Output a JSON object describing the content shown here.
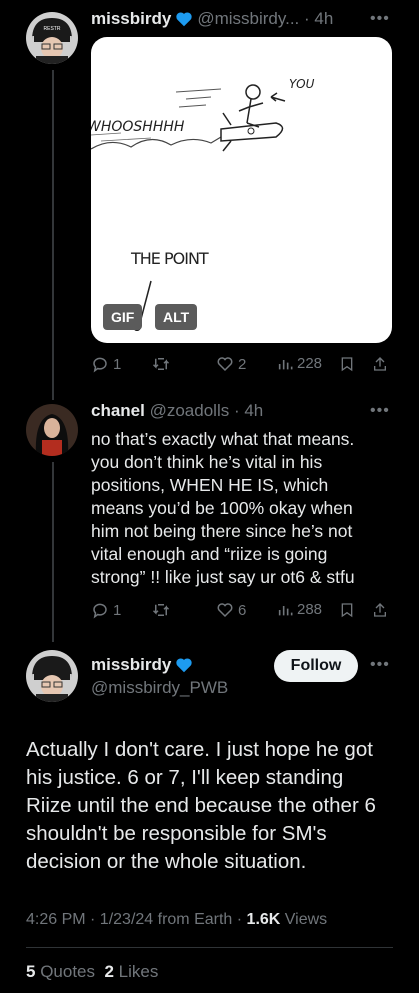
{
  "tweet1": {
    "display_name": "missbirdy",
    "handle_time": "@missbirdy... · 4h",
    "media": {
      "sketch_whoosh": "WHOOSHHHH",
      "sketch_you": "YOU",
      "sketch_point": "THE POINT",
      "gif_label": "GIF",
      "alt_label": "ALT"
    },
    "actions": {
      "replies": "1",
      "likes": "2",
      "views": "228"
    }
  },
  "tweet2": {
    "display_name": "chanel",
    "handle_time": "@zoadolls · 4h",
    "text_lines": [
      "no that’s exactly what that means.",
      "you don’t think he’s vital in his",
      "positions, WHEN HE IS, which",
      "means you’d be 100% okay when",
      "him not being there since he’s not",
      "vital enough and “riize is going",
      "strong” !! like just say ur ot6 & stfu"
    ],
    "actions": {
      "replies": "1",
      "likes": "6",
      "views": "288"
    }
  },
  "main_tweet": {
    "display_name": "missbirdy",
    "handle": "@missbirdy_PWB",
    "follow_label": "Follow",
    "text_lines": [
      "Actually I don't care. I just hope he got",
      "his justice. 6 or 7, I'll keep standing",
      "Riize until the end because the other 6",
      "shouldn't be responsible for SM's",
      "decision or the whole situation."
    ],
    "meta_prefix": "4:26 PM · 1/23/24 from Earth · ",
    "views_count": "1.6K",
    "views_label": " Views",
    "quotes_count": "5",
    "quotes_label": " Quotes",
    "likes_count": "2",
    "likes_label": " Likes"
  },
  "colors": {
    "background": "#000000",
    "verified": "#1d9bf0",
    "muted": "#71767b"
  }
}
